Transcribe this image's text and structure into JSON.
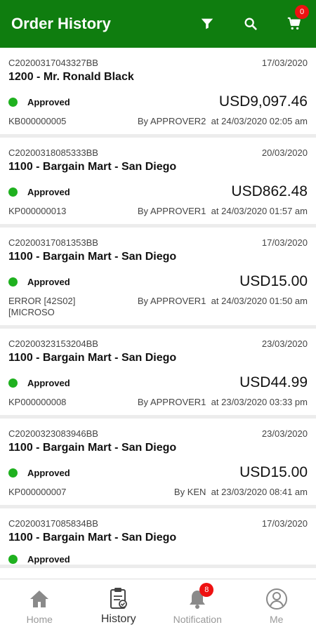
{
  "app_bar": {
    "title": "Order History",
    "cart_count": "0"
  },
  "orders": [
    {
      "code": "C20200317043327BB",
      "date": "17/03/2020",
      "customer": "1200 - Mr. Ronald Black",
      "status": "Approved",
      "amount": "USD9,097.46",
      "ref": "KB000000005",
      "approver": "By APPROVER2",
      "approved_at": "at 24/03/2020 02:05 am"
    },
    {
      "code": "C20200318085333BB",
      "date": "20/03/2020",
      "customer": "1100 - Bargain Mart - San Diego",
      "status": "Approved",
      "amount": "USD862.48",
      "ref": "KP000000013",
      "approver": "By APPROVER1",
      "approved_at": "at 24/03/2020 01:57 am"
    },
    {
      "code": "C20200317081353BB",
      "date": "17/03/2020",
      "customer": "1100 - Bargain Mart - San Diego",
      "status": "Approved",
      "amount": "USD15.00",
      "ref": "ERROR [42S02] [MICROSO",
      "approver": "By APPROVER1",
      "approved_at": "at 24/03/2020 01:50 am"
    },
    {
      "code": "C20200323153204BB",
      "date": "23/03/2020",
      "customer": "1100 - Bargain Mart - San Diego",
      "status": "Approved",
      "amount": "USD44.99",
      "ref": "KP000000008",
      "approver": "By APPROVER1",
      "approved_at": "at 23/03/2020 03:33 pm"
    },
    {
      "code": "C20200323083946BB",
      "date": "23/03/2020",
      "customer": "1100 - Bargain Mart - San Diego",
      "status": "Approved",
      "amount": "USD15.00",
      "ref": "KP000000007",
      "approver": "By KEN",
      "approved_at": "at 23/03/2020 08:41 am"
    },
    {
      "code": "C20200317085834BB",
      "date": "17/03/2020",
      "customer": "1100 - Bargain Mart - San Diego",
      "status": "Approved",
      "amount": "",
      "ref": "",
      "approver": "",
      "approved_at": ""
    }
  ],
  "bottom_nav": {
    "home": "Home",
    "history": "History",
    "notification": "Notification",
    "notification_count": "8",
    "me": "Me"
  },
  "colors": {
    "brand": "#0f7d0f",
    "approved": "#1fb11f",
    "badge": "#e11111"
  },
  "icons": {
    "filter": "filter-icon",
    "search": "search-icon",
    "cart": "cart-icon",
    "home": "home-icon",
    "history": "clipboard-icon",
    "notification": "bell-icon",
    "me": "user-icon"
  }
}
